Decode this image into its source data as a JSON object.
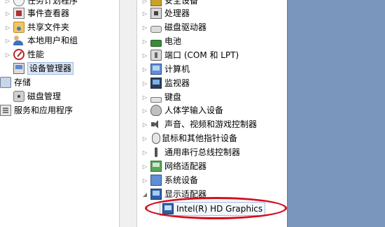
{
  "left_tree": {
    "items": [
      {
        "label": "任务计划程序",
        "icon": "task-scheduler-icon"
      },
      {
        "label": "事件查看器",
        "icon": "event-viewer-icon"
      },
      {
        "label": "共享文件夹",
        "icon": "shared-folders-icon"
      },
      {
        "label": "本地用户和组",
        "icon": "users-icon"
      },
      {
        "label": "性能",
        "icon": "performance-icon"
      },
      {
        "label": "设备管理器",
        "icon": "device-manager-icon"
      },
      {
        "label": "存储",
        "icon": "storage-icon"
      },
      {
        "label": "磁盘管理",
        "icon": "disk-icon"
      },
      {
        "label": "服务和应用程序",
        "icon": "services-icon"
      }
    ]
  },
  "device_tree": {
    "items": [
      {
        "label": "安全设备",
        "icon": "security-device-icon"
      },
      {
        "label": "处理器",
        "icon": "processor-icon"
      },
      {
        "label": "磁盘驱动器",
        "icon": "disk-drive-icon"
      },
      {
        "label": "电池",
        "icon": "battery-icon"
      },
      {
        "label": "端口 (COM 和 LPT)",
        "icon": "port-icon"
      },
      {
        "label": "计算机",
        "icon": "computer-icon"
      },
      {
        "label": "监视器",
        "icon": "monitor-icon"
      },
      {
        "label": "键盘",
        "icon": "keyboard-icon"
      },
      {
        "label": "人体学输入设备",
        "icon": "hid-icon"
      },
      {
        "label": "声音、视频和游戏控制器",
        "icon": "sound-icon"
      },
      {
        "label": "鼠标和其他指针设备",
        "icon": "mouse-icon"
      },
      {
        "label": "通用串行总线控制器",
        "icon": "usb-icon"
      },
      {
        "label": "网络适配器",
        "icon": "network-adapter-icon"
      },
      {
        "label": "系统设备",
        "icon": "system-device-icon"
      },
      {
        "label": "显示适配器",
        "icon": "display-adapter-icon"
      }
    ],
    "child": {
      "label": "Intel(R) HD Graphics",
      "icon": "graphics-card-icon"
    }
  },
  "colors": {
    "highlight_ellipse": "#d40f1f",
    "desktop_background": "#7a96bd",
    "selection": "#dbe7f7"
  }
}
